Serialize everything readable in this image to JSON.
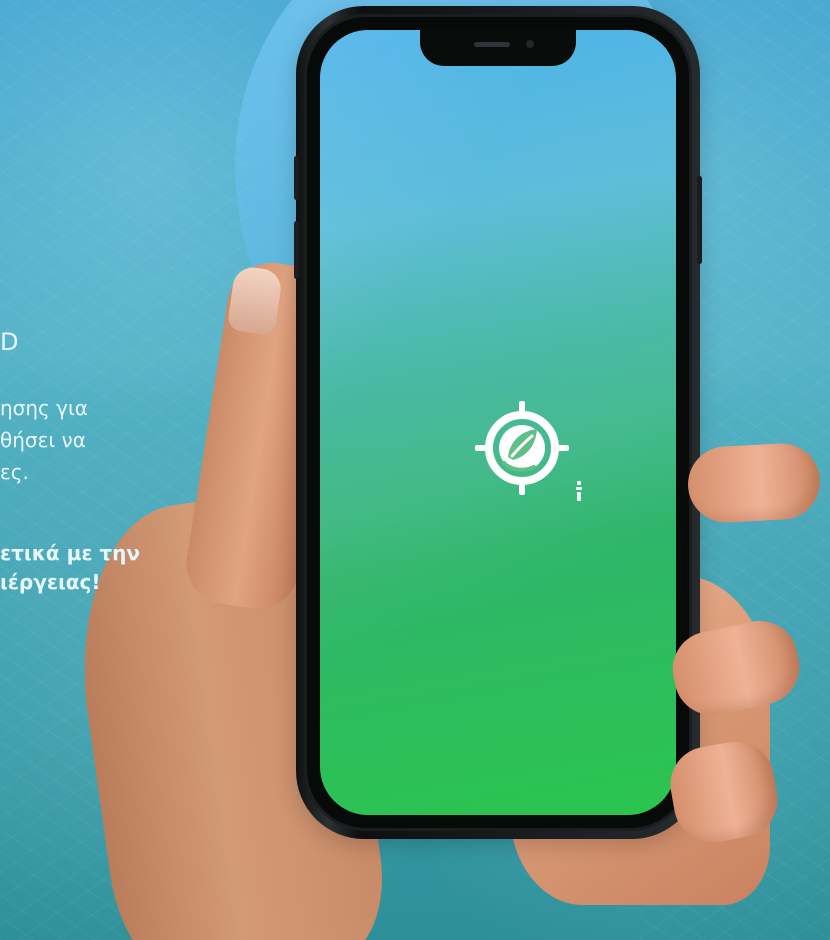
{
  "page_text": {
    "fragment_1": "D",
    "fragment_2": "ησης για",
    "fragment_3": "θήσει να",
    "fragment_4": "ες.",
    "fragment_5": "ετικά με την",
    "fragment_6": "ιέργειας!"
  },
  "icons": {
    "app_logo": "target-leaf-icon",
    "brand_mark": "small-vertical-brand-mark"
  },
  "colors": {
    "background_top": "#4ba9d3",
    "background_bottom": "#2d8f98",
    "screen_top": "#4bb2ea",
    "screen_bottom": "#2bc54e",
    "text": "#e6f7fb",
    "logo": "#ffffff"
  }
}
